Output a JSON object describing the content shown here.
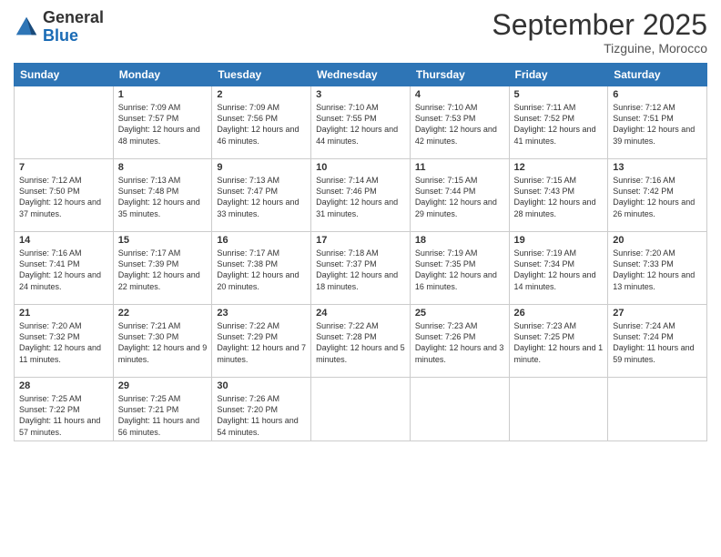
{
  "logo": {
    "line1": "General",
    "line2": "Blue"
  },
  "title": "September 2025",
  "subtitle": "Tizguine, Morocco",
  "weekdays": [
    "Sunday",
    "Monday",
    "Tuesday",
    "Wednesday",
    "Thursday",
    "Friday",
    "Saturday"
  ],
  "weeks": [
    [
      {
        "day": "",
        "info": ""
      },
      {
        "day": "1",
        "info": "Sunrise: 7:09 AM\nSunset: 7:57 PM\nDaylight: 12 hours and 48 minutes."
      },
      {
        "day": "2",
        "info": "Sunrise: 7:09 AM\nSunset: 7:56 PM\nDaylight: 12 hours and 46 minutes."
      },
      {
        "day": "3",
        "info": "Sunrise: 7:10 AM\nSunset: 7:55 PM\nDaylight: 12 hours and 44 minutes."
      },
      {
        "day": "4",
        "info": "Sunrise: 7:10 AM\nSunset: 7:53 PM\nDaylight: 12 hours and 42 minutes."
      },
      {
        "day": "5",
        "info": "Sunrise: 7:11 AM\nSunset: 7:52 PM\nDaylight: 12 hours and 41 minutes."
      },
      {
        "day": "6",
        "info": "Sunrise: 7:12 AM\nSunset: 7:51 PM\nDaylight: 12 hours and 39 minutes."
      }
    ],
    [
      {
        "day": "7",
        "info": "Sunrise: 7:12 AM\nSunset: 7:50 PM\nDaylight: 12 hours and 37 minutes."
      },
      {
        "day": "8",
        "info": "Sunrise: 7:13 AM\nSunset: 7:48 PM\nDaylight: 12 hours and 35 minutes."
      },
      {
        "day": "9",
        "info": "Sunrise: 7:13 AM\nSunset: 7:47 PM\nDaylight: 12 hours and 33 minutes."
      },
      {
        "day": "10",
        "info": "Sunrise: 7:14 AM\nSunset: 7:46 PM\nDaylight: 12 hours and 31 minutes."
      },
      {
        "day": "11",
        "info": "Sunrise: 7:15 AM\nSunset: 7:44 PM\nDaylight: 12 hours and 29 minutes."
      },
      {
        "day": "12",
        "info": "Sunrise: 7:15 AM\nSunset: 7:43 PM\nDaylight: 12 hours and 28 minutes."
      },
      {
        "day": "13",
        "info": "Sunrise: 7:16 AM\nSunset: 7:42 PM\nDaylight: 12 hours and 26 minutes."
      }
    ],
    [
      {
        "day": "14",
        "info": "Sunrise: 7:16 AM\nSunset: 7:41 PM\nDaylight: 12 hours and 24 minutes."
      },
      {
        "day": "15",
        "info": "Sunrise: 7:17 AM\nSunset: 7:39 PM\nDaylight: 12 hours and 22 minutes."
      },
      {
        "day": "16",
        "info": "Sunrise: 7:17 AM\nSunset: 7:38 PM\nDaylight: 12 hours and 20 minutes."
      },
      {
        "day": "17",
        "info": "Sunrise: 7:18 AM\nSunset: 7:37 PM\nDaylight: 12 hours and 18 minutes."
      },
      {
        "day": "18",
        "info": "Sunrise: 7:19 AM\nSunset: 7:35 PM\nDaylight: 12 hours and 16 minutes."
      },
      {
        "day": "19",
        "info": "Sunrise: 7:19 AM\nSunset: 7:34 PM\nDaylight: 12 hours and 14 minutes."
      },
      {
        "day": "20",
        "info": "Sunrise: 7:20 AM\nSunset: 7:33 PM\nDaylight: 12 hours and 13 minutes."
      }
    ],
    [
      {
        "day": "21",
        "info": "Sunrise: 7:20 AM\nSunset: 7:32 PM\nDaylight: 12 hours and 11 minutes."
      },
      {
        "day": "22",
        "info": "Sunrise: 7:21 AM\nSunset: 7:30 PM\nDaylight: 12 hours and 9 minutes."
      },
      {
        "day": "23",
        "info": "Sunrise: 7:22 AM\nSunset: 7:29 PM\nDaylight: 12 hours and 7 minutes."
      },
      {
        "day": "24",
        "info": "Sunrise: 7:22 AM\nSunset: 7:28 PM\nDaylight: 12 hours and 5 minutes."
      },
      {
        "day": "25",
        "info": "Sunrise: 7:23 AM\nSunset: 7:26 PM\nDaylight: 12 hours and 3 minutes."
      },
      {
        "day": "26",
        "info": "Sunrise: 7:23 AM\nSunset: 7:25 PM\nDaylight: 12 hours and 1 minute."
      },
      {
        "day": "27",
        "info": "Sunrise: 7:24 AM\nSunset: 7:24 PM\nDaylight: 11 hours and 59 minutes."
      }
    ],
    [
      {
        "day": "28",
        "info": "Sunrise: 7:25 AM\nSunset: 7:22 PM\nDaylight: 11 hours and 57 minutes."
      },
      {
        "day": "29",
        "info": "Sunrise: 7:25 AM\nSunset: 7:21 PM\nDaylight: 11 hours and 56 minutes."
      },
      {
        "day": "30",
        "info": "Sunrise: 7:26 AM\nSunset: 7:20 PM\nDaylight: 11 hours and 54 minutes."
      },
      {
        "day": "",
        "info": ""
      },
      {
        "day": "",
        "info": ""
      },
      {
        "day": "",
        "info": ""
      },
      {
        "day": "",
        "info": ""
      }
    ]
  ]
}
